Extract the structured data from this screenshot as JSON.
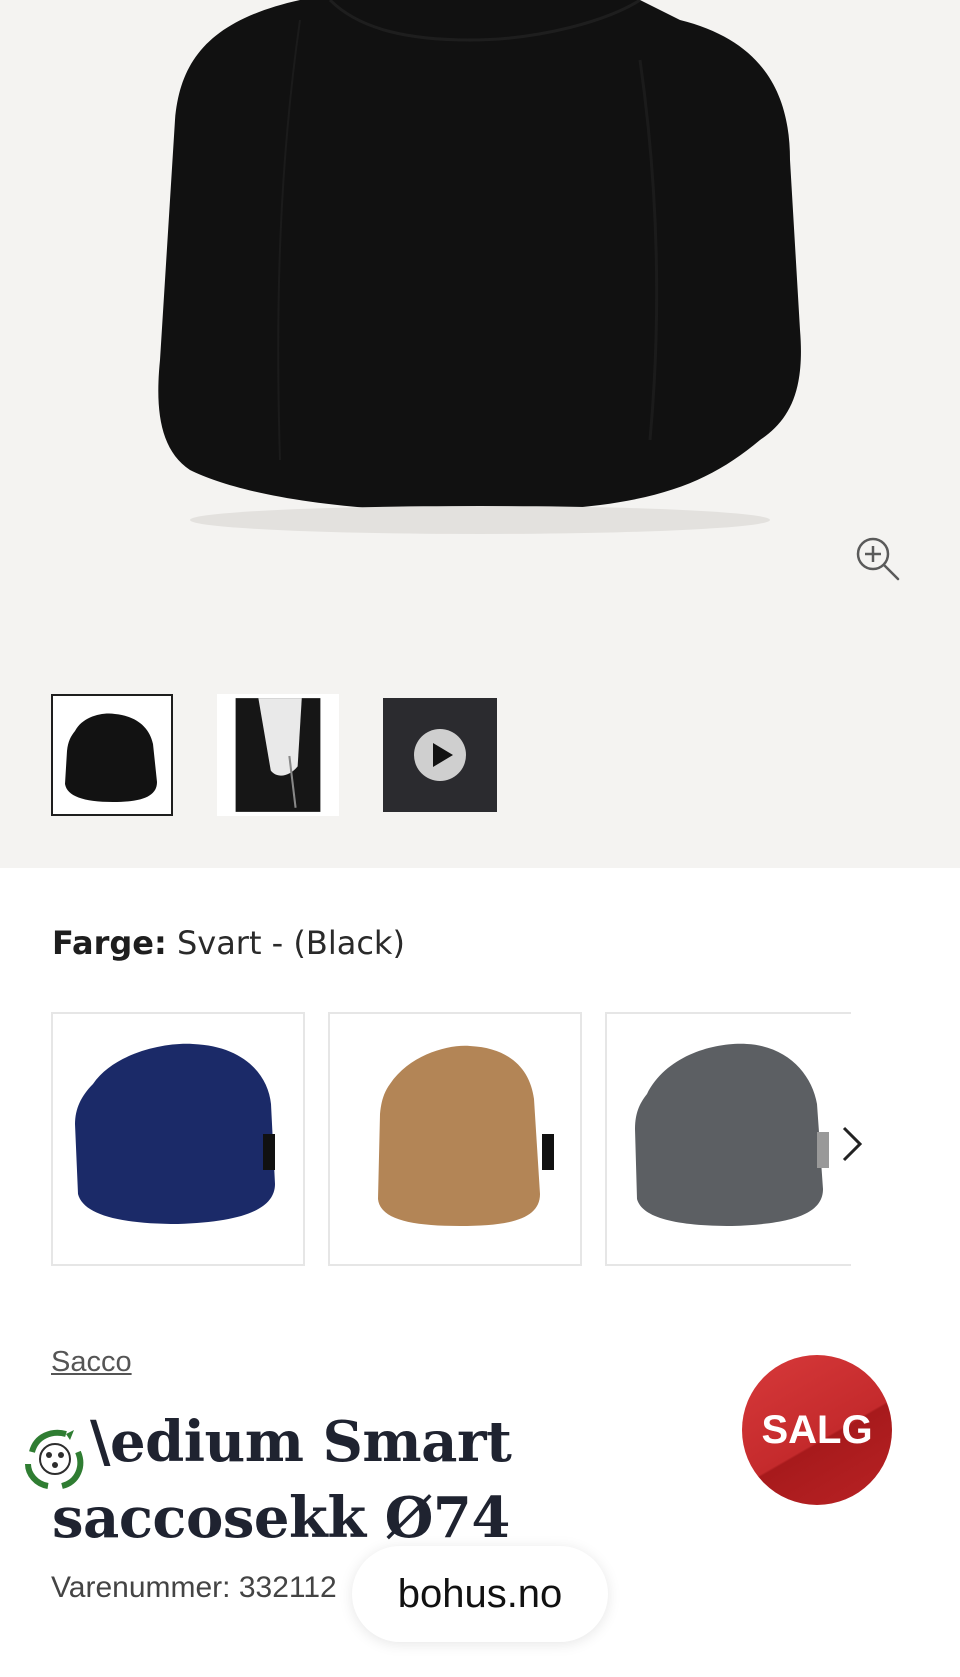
{
  "gallery": {
    "main_image": "black-bean-bag",
    "zoom_icon": "zoom-in-icon",
    "thumbnails": [
      {
        "name": "black-bean-bag",
        "selected": true
      },
      {
        "name": "zipper-detail",
        "selected": false
      },
      {
        "name": "video",
        "selected": false,
        "icon": "play-icon"
      }
    ]
  },
  "color_picker": {
    "label": "Farge:",
    "value": " Svart - (Black)",
    "swatches": [
      "navy",
      "tan",
      "grey"
    ],
    "next_icon": "chevron-right-icon"
  },
  "product": {
    "brand": "Sacco",
    "title": "Medium Smart saccosekk Ø74",
    "title_visible_line1": "\\edium Smart",
    "title_visible_line2": "saccosekk Ø74",
    "sku_label": "Varenummer: 332112",
    "sale_badge": "SALG"
  },
  "overlay": {
    "domain": "bohus.no",
    "eco_icon": "recycle-icon"
  },
  "colors": {
    "hero_bg": "#f4f3f1",
    "sale_red": "#c42a2c",
    "title_dark": "#1f2330"
  }
}
